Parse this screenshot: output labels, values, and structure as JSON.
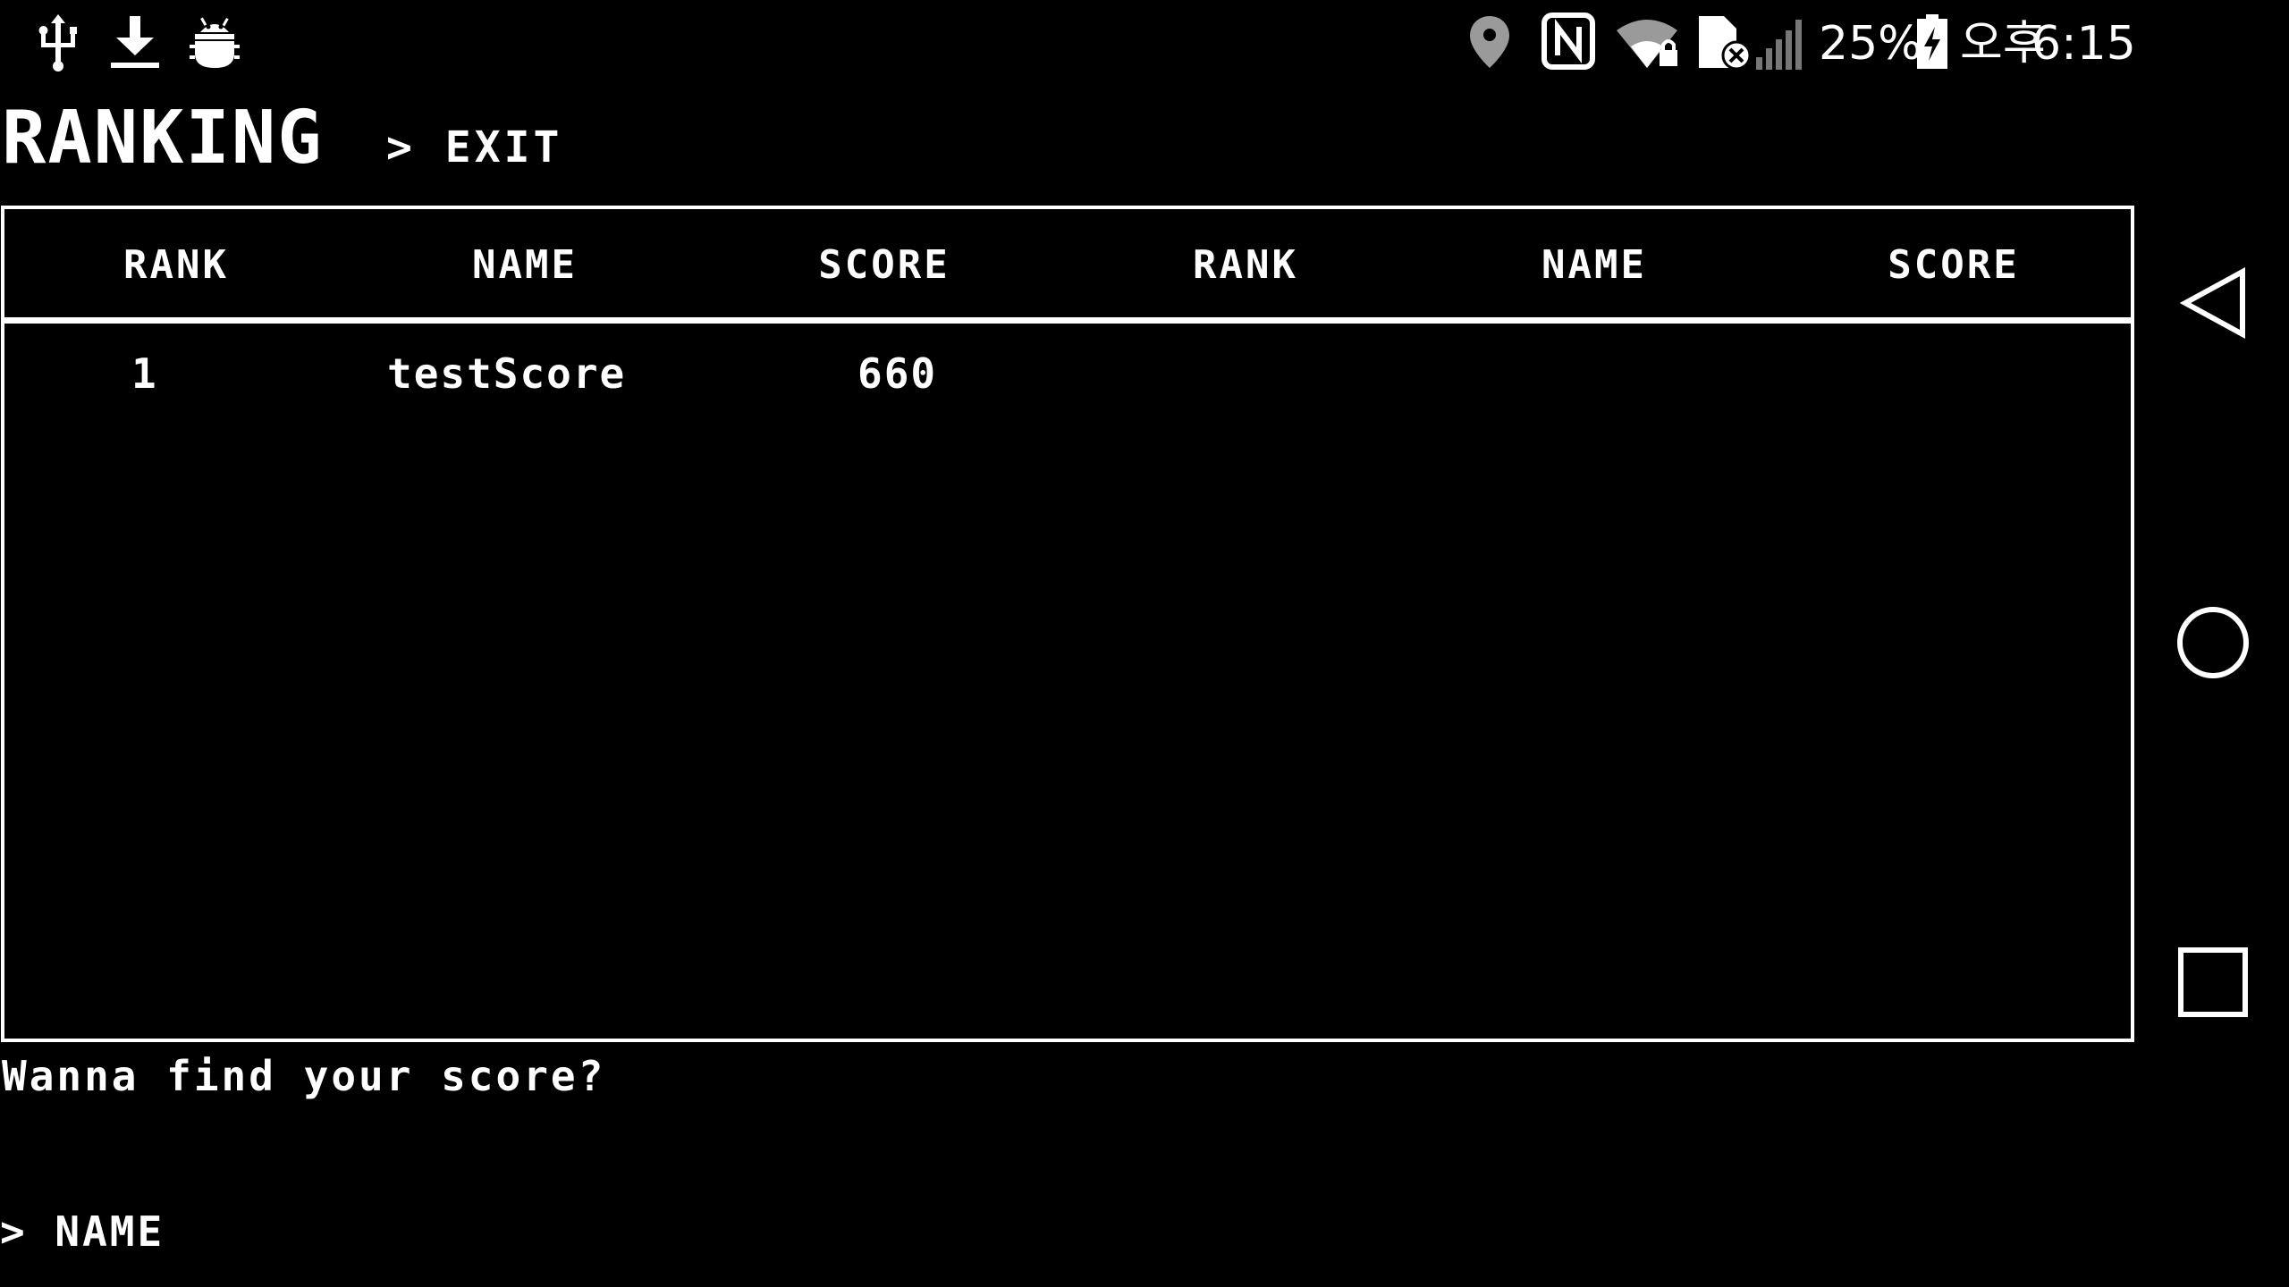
{
  "status_bar": {
    "left_icons": [
      "usb-icon",
      "download-icon",
      "android-debug-icon"
    ],
    "right_icons": [
      "location-icon",
      "nfc-icon",
      "wifi-locked-icon",
      "no-sim-icon",
      "signal-icon",
      "battery-charging-icon"
    ],
    "battery_percent": "25%",
    "ampm": "오후",
    "time": "6:15"
  },
  "header": {
    "title": "RANKING",
    "exit_label": "> EXIT"
  },
  "ranking_table": {
    "columns": [
      "RANK",
      "NAME",
      "SCORE",
      "RANK",
      "NAME",
      "SCORE"
    ],
    "rows": [
      {
        "rank": "1",
        "name": "testScore",
        "score": "660"
      }
    ]
  },
  "search": {
    "prompt": "Wanna find your score?",
    "input_value": "> NAME"
  },
  "nav_bar": {
    "buttons": [
      "back-icon",
      "home-icon",
      "recents-icon"
    ]
  },
  "colors": {
    "background": "#000000",
    "foreground": "#ffffff",
    "status_icon_gray": "#9a9a9a"
  }
}
